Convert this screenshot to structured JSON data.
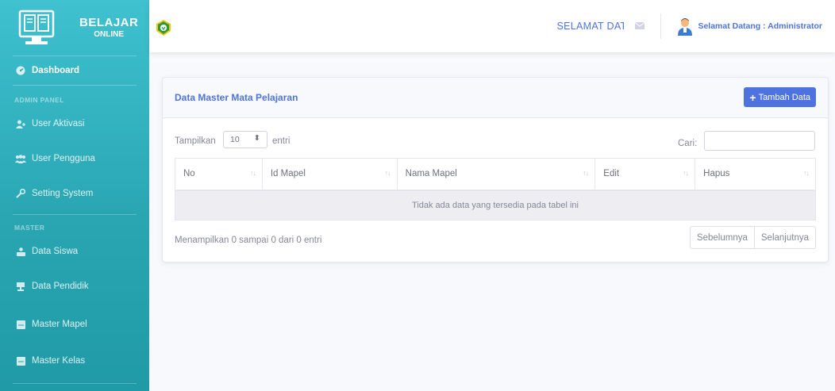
{
  "brand": {
    "line1": "BELAJAR",
    "line2": "ONLINE"
  },
  "sidebar": {
    "dashboard": "Dashboard",
    "heading_admin": "ADMIN PANEL",
    "admin_items": [
      {
        "label": "User Aktivasi",
        "icon": "user-plus-icon"
      },
      {
        "label": "User Pengguna",
        "icon": "users-icon"
      },
      {
        "label": "Setting System",
        "icon": "wrench-icon"
      }
    ],
    "heading_master": "MASTER",
    "master_items": [
      {
        "label": "Data Siswa",
        "icon": "students-icon"
      },
      {
        "label": "Data Pendidik",
        "icon": "teacher-icon"
      },
      {
        "label": "Master Mapel",
        "icon": "book-icon"
      },
      {
        "label": "Master Kelas",
        "icon": "book-icon"
      }
    ]
  },
  "topbar": {
    "welcome": "SELAMAT DATA",
    "user_label": "Selamat Datang : Administrator"
  },
  "card": {
    "title": "Data Master Mata Pelajaran",
    "add_button": "Tambah Data",
    "show_label": "Tampilkan",
    "show_value": "10",
    "entries_label": "entri",
    "search_label": "Cari:",
    "columns": [
      "No",
      "Id Mapel",
      "Nama Mapel",
      "Edit",
      "Hapus"
    ],
    "empty_message": "Tidak ada data yang tersedia pada tabel ini",
    "info": "Menampilkan 0 sampai 0 dari 0 entri",
    "prev": "Sebelumnya",
    "next": "Selanjutnya"
  },
  "colors": {
    "primary": "#4e73df",
    "sidebar": "#36b9cc"
  }
}
